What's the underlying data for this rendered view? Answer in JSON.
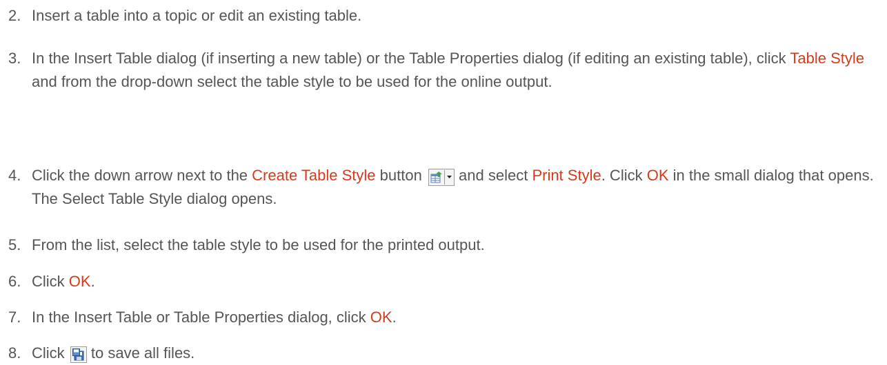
{
  "steps": [
    {
      "number": "2.",
      "text": "Insert a table into a topic or edit an existing table."
    },
    {
      "number": "3.",
      "part1": "In the Insert Table dialog (if inserting a new table) or the Table Properties dialog (if editing an existing table), click ",
      "ui1": "Table Style",
      "part2": " and from the drop-down select the table style to be used for the online output."
    },
    {
      "number": "4.",
      "part1": "Click the down arrow next to the ",
      "ui1": "Create Table Style",
      "part2": " button ",
      "part3": " and select ",
      "ui2": "Print Style",
      "part4": ". Click ",
      "ui3": "OK",
      "part5": " in the small dialog that opens. The Select Table Style dialog opens.",
      "icon": "create-table-style-icon"
    },
    {
      "number": "5.",
      "text": "From the list, select the table style to be used for the printed output."
    },
    {
      "number": "6.",
      "part1": "Click ",
      "ui1": "OK",
      "part2": "."
    },
    {
      "number": "7.",
      "part1": "In the Insert Table or Table Properties dialog, click ",
      "ui1": "OK",
      "part2": "."
    },
    {
      "number": "8.",
      "part1": "Click ",
      "part2": " to save all files.",
      "icon": "save-all-icon"
    }
  ],
  "colors": {
    "text": "#555555",
    "ui_term": "#d63a1a"
  }
}
